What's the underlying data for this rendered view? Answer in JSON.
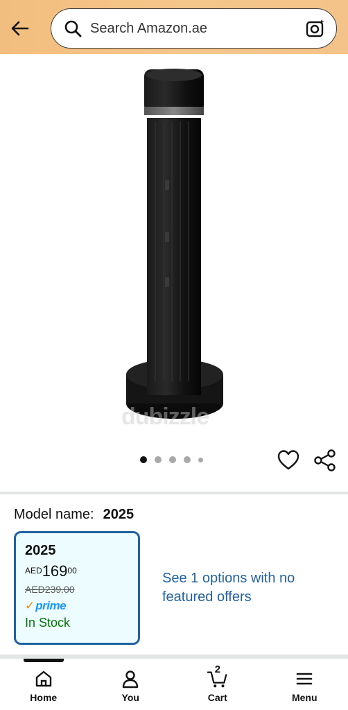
{
  "header": {
    "search_placeholder": "Search Amazon.ae",
    "icons": [
      "back-arrow-icon",
      "search-icon",
      "camera-search-icon"
    ]
  },
  "product": {
    "image_description": "Black tower fan",
    "watermark": "dubizzle",
    "carousel": {
      "count": 5,
      "active_index": 0
    }
  },
  "variation": {
    "label": "Model name:",
    "value": "2025",
    "selected_card": {
      "title": "2025",
      "currency": "AED",
      "price_whole": "169",
      "price_fraction": "00",
      "list_price": "AED239.00",
      "prime_label": "prime",
      "availability": "In Stock"
    },
    "see_options": "See 1 options with no featured offers"
  },
  "bottom_nav": {
    "items": [
      {
        "label": "Home",
        "icon": "home-icon"
      },
      {
        "label": "You",
        "icon": "user-icon"
      },
      {
        "label": "Cart",
        "icon": "cart-icon",
        "count": "2"
      },
      {
        "label": "Menu",
        "icon": "menu-icon"
      }
    ]
  },
  "colors": {
    "header_bg": "#f3c389",
    "link": "#2162a1",
    "card_border": "#2162a1",
    "card_bg": "#edfdff",
    "in_stock": "#007600",
    "prime_blue": "#1a98ff",
    "prime_check": "#f08804"
  }
}
